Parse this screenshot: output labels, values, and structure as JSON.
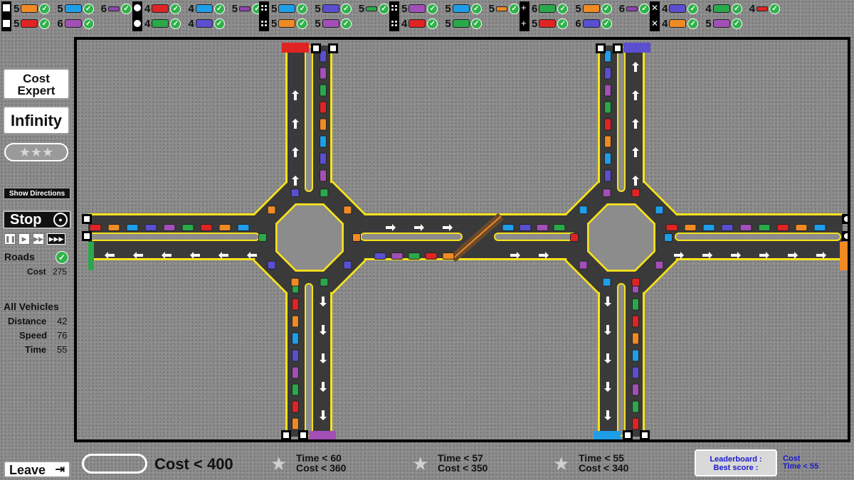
{
  "goals": [
    {
      "icon": "square",
      "rows": [
        [
          {
            "n": "5",
            "veh": "car",
            "color": "#f08a24"
          },
          {
            "n": "5",
            "veh": "car",
            "color": "#1e9ee8"
          },
          {
            "n": "6",
            "veh": "bike",
            "color": "#8e44ad"
          }
        ],
        [
          {
            "n": "5",
            "veh": "car",
            "color": "#e02424"
          },
          {
            "n": "6",
            "veh": "car",
            "color": "#a24fb6"
          }
        ]
      ]
    },
    {
      "icon": "circle",
      "rows": [
        [
          {
            "n": "4",
            "veh": "car",
            "color": "#e02424"
          },
          {
            "n": "4",
            "veh": "car",
            "color": "#1e9ee8"
          },
          {
            "n": "5",
            "veh": "bike",
            "color": "#8e44ad"
          }
        ],
        [
          {
            "n": "4",
            "veh": "car",
            "color": "#2aa84a"
          },
          {
            "n": "4",
            "veh": "car",
            "color": "#5a4fcf"
          }
        ]
      ]
    },
    {
      "icon": "dots",
      "rows": [
        [
          {
            "n": "5",
            "veh": "car",
            "color": "#1e9ee8"
          },
          {
            "n": "5",
            "veh": "car",
            "color": "#5a4fcf"
          },
          {
            "n": "5",
            "veh": "bike",
            "color": "#2aa84a"
          }
        ],
        [
          {
            "n": "5",
            "veh": "car",
            "color": "#f08a24"
          },
          {
            "n": "5",
            "veh": "car",
            "color": "#a24fb6"
          }
        ]
      ]
    },
    {
      "icon": "dots",
      "rows": [
        [
          {
            "n": "5",
            "veh": "car",
            "color": "#a24fb6"
          },
          {
            "n": "5",
            "veh": "car",
            "color": "#1e9ee8"
          },
          {
            "n": "5",
            "veh": "bike",
            "color": "#f08a24"
          }
        ],
        [
          {
            "n": "4",
            "veh": "car",
            "color": "#e02424"
          },
          {
            "n": "5",
            "veh": "car",
            "color": "#2aa84a"
          }
        ]
      ]
    },
    {
      "icon": "plus",
      "rows": [
        [
          {
            "n": "6",
            "veh": "car",
            "color": "#2aa84a"
          },
          {
            "n": "5",
            "veh": "car",
            "color": "#f08a24"
          },
          {
            "n": "6",
            "veh": "bike",
            "color": "#8e44ad"
          }
        ],
        [
          {
            "n": "5",
            "veh": "car",
            "color": "#e02424"
          },
          {
            "n": "6",
            "veh": "car",
            "color": "#5a4fcf"
          }
        ]
      ]
    },
    {
      "icon": "cross",
      "rows": [
        [
          {
            "n": "4",
            "veh": "car",
            "color": "#5a4fcf"
          },
          {
            "n": "4",
            "veh": "car",
            "color": "#2aa84a"
          },
          {
            "n": "4",
            "veh": "bike",
            "color": "#e02424"
          }
        ],
        [
          {
            "n": "4",
            "veh": "car",
            "color": "#f08a24"
          },
          {
            "n": "5",
            "veh": "car",
            "color": "#a24fb6"
          }
        ]
      ]
    }
  ],
  "panel": {
    "level": "Cost Expert",
    "mode": "Infinity",
    "stars": "★★★",
    "show_directions": "Show Directions",
    "stop": "Stop",
    "roads_label": "Roads",
    "cost_label": "Cost",
    "cost_value": "275",
    "all_vehicles": "All Vehicles",
    "distance_label": "Distance",
    "distance_value": "42",
    "speed_label": "Speed",
    "speed_value": "76",
    "time_label": "Time",
    "time_value": "55",
    "leave": "Leave"
  },
  "bottom": {
    "cost_target": "Cost < 400",
    "achievements": [
      {
        "time": "Time < 60",
        "cost": "Cost < 360"
      },
      {
        "time": "Time < 57",
        "cost": "Cost < 350"
      },
      {
        "time": "Time < 55",
        "cost": "Cost < 340"
      }
    ],
    "leaderboard_title": "Leaderboard :",
    "leaderboard_sub": "Best score :",
    "best_cost": "Cost",
    "best_time": "Time < 55"
  },
  "colors": {
    "red": "#e02424",
    "orange": "#f08a24",
    "blue": "#1e9ee8",
    "indigo": "#5a4fcf",
    "purple": "#a24fb6",
    "green": "#2aa84a",
    "road": "#3a3a3a",
    "edge": "#f7e21b"
  }
}
